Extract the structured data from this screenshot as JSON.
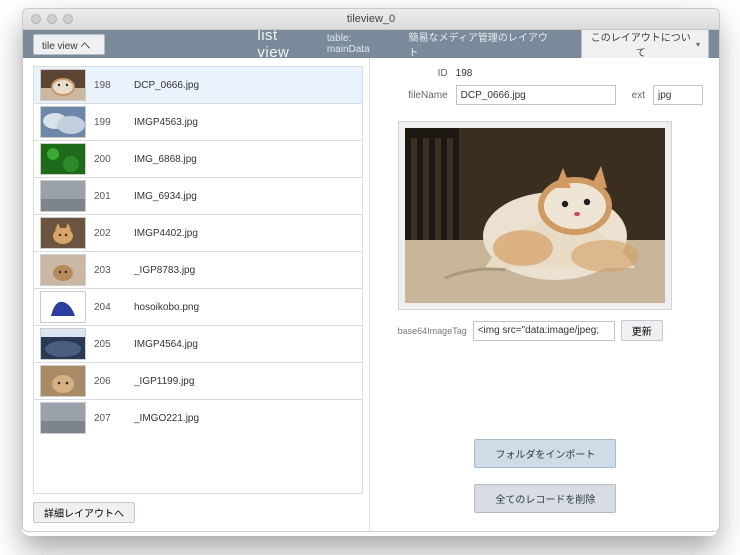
{
  "window": {
    "title": "tileview_0"
  },
  "toolbar": {
    "tileview_btn": "tile view へ",
    "listview_label": "list view",
    "table_label": "table: ",
    "table_name": "mainData",
    "description": "簡易なメディア管理のレイアウト",
    "about_btn": "このレイアウトについて"
  },
  "list": {
    "selected_id": "198",
    "rows": [
      {
        "id": "198",
        "fname": "DCP_0666.jpg",
        "thumb": "cat1"
      },
      {
        "id": "199",
        "fname": "IMGP4563.jpg",
        "thumb": "cloud1"
      },
      {
        "id": "200",
        "fname": "IMG_6868.jpg",
        "thumb": "green"
      },
      {
        "id": "201",
        "fname": "IMG_6934.jpg",
        "thumb": "gray"
      },
      {
        "id": "202",
        "fname": "IMGP4402.jpg",
        "thumb": "cat2"
      },
      {
        "id": "203",
        "fname": "_IGP8783.jpg",
        "thumb": "cat3"
      },
      {
        "id": "204",
        "fname": "hosoikobo.png",
        "thumb": "logo"
      },
      {
        "id": "205",
        "fname": "IMGP4564.jpg",
        "thumb": "cloud2"
      },
      {
        "id": "206",
        "fname": "_IGP1199.jpg",
        "thumb": "cat4"
      },
      {
        "id": "207",
        "fname": "_IMGO221.jpg",
        "thumb": "gray"
      }
    ]
  },
  "left_footer": {
    "detail_btn": "詳細レイアウトへ"
  },
  "detail": {
    "id_label": "ID",
    "id_value": "198",
    "filename_label": "fileName",
    "filename_value": "DCP_0666.jpg",
    "ext_label": "ext",
    "ext_value": "jpg",
    "b64_label": "base64ImageTag",
    "b64_value": "<img src=\"data:image/jpeg;",
    "update_btn": "更新"
  },
  "actions": {
    "import_btn": "フォルダをインポート",
    "delete_all_btn": "全てのレコードを削除"
  },
  "thumbs": {
    "cat1": "<svg viewBox='0 0 44 30'><rect width='44' height='30' fill='#5a4632'/><rect x='0' y='18' width='44' height='12' fill='#cbb8a0'/><ellipse cx='22' cy='17' rx='11' ry='8' fill='#e8dccb'/><ellipse cx='22' cy='17' rx='11' ry='8' fill='none' stroke='#c8976a' stroke-width='2'/><circle cx='18' cy='15' r='1.2' fill='#2a2a2a'/><circle cx='26' cy='15' r='1.2' fill='#2a2a2a'/></svg>",
    "cloud1": "<svg viewBox='0 0 44 30'><rect width='44' height='30' fill='#6d87a8'/><ellipse cx='14' cy='14' rx='12' ry='8' fill='#d9e2ec'/><ellipse cx='30' cy='18' rx='14' ry='9' fill='#c2cfdc'/></svg>",
    "green": "<svg viewBox='0 0 44 30'><rect width='44' height='30' fill='#1d6b1a'/><circle cx='12' cy='10' r='6' fill='#3aa833'/><circle cx='30' cy='20' r='8' fill='#2e8a28'/></svg>",
    "gray": "<svg viewBox='0 0 44 30'><rect width='44' height='30' fill='#9aa1a8'/><rect x='0' y='18' width='44' height='12' fill='#7d848b'/></svg>",
    "cat2": "<svg viewBox='0 0 44 30'><rect width='44' height='30' fill='#6b5440'/><ellipse cx='22' cy='18' rx='10' ry='8' fill='#d9a46a'/><polygon points='14,12 17,5 20,12' fill='#d9a46a'/><polygon points='24,12 27,5 30,12' fill='#d9a46a'/><circle cx='19' cy='17' r='1.2' fill='#2a2a2a'/><circle cx='25' cy='17' r='1.2' fill='#2a2a2a'/></svg>",
    "cat3": "<svg viewBox='0 0 44 30'><rect width='44' height='30' fill='#c9b9a4'/><ellipse cx='22' cy='18' rx='10' ry='8' fill='#b78b59'/><circle cx='19' cy='17' r='1.2' fill='#2a2a2a'/><circle cx='25' cy='17' r='1.2' fill='#2a2a2a'/></svg>",
    "logo": "<svg viewBox='0 0 44 30'><rect width='44' height='30' fill='#ffffff'/><path d='M10 24 Q14 8 22 10 Q30 12 34 24 Z' fill='#2a3f9e'/></svg>",
    "cloud2": "<svg viewBox='0 0 44 30'><rect width='44' height='30' fill='#2a3a55'/><ellipse cx='22' cy='20' rx='18' ry='8' fill='#4a5f80'/><rect x='0' y='0' width='44' height='8' fill='#dce5ef'/></svg>",
    "cat4": "<svg viewBox='0 0 44 30'><rect width='44' height='30' fill='#a98a66'/><ellipse cx='22' cy='18' rx='11' ry='9' fill='#d7b185'/><circle cx='18' cy='17' r='1.3' fill='#2a2a2a'/><circle cx='26' cy='17' r='1.3' fill='#2a2a2a'/></svg>",
    "preview": "<svg viewBox='0 0 260 175' preserveAspectRatio='xMidYMid slice'><rect width='260' height='175' fill='#3a2e20'/><rect x='0' y='0' width='54' height='175' fill='#1e1812'/><rect x='6' y='10' width='6' height='150' fill='#3a3226'/><rect x='18' y='10' width='6' height='150' fill='#3a3226'/><rect x='30' y='10' width='6' height='150' fill='#3a3226'/><rect x='42' y='10' width='6' height='150' fill='#3a3226'/><rect x='0' y='112' width='260' height='63' fill='#c9b69a'/><ellipse cx='150' cy='108' rx='72' ry='44' fill='#ece1d0'/><path d='M80 140 Q110 90 150 92 Q200 94 230 140 Z' fill='#e9dcc6'/><ellipse cx='170' cy='78' rx='34' ry='26' fill='#efe5d4'/><path d='M150 60 L158 40 L166 60 Z' fill='#d59a62'/><path d='M186 58 L196 38 L202 60 Z' fill='#d59a62'/><ellipse cx='170' cy='78' rx='34' ry='26' fill='none' stroke='#cf9a63' stroke-width='6'/><ellipse cx='118' cy='120' rx='30' ry='18' fill='#d6a067' opacity='.7'/><ellipse cx='200' cy='128' rx='34' ry='16' fill='#d6a067' opacity='.6'/><circle cx='160' cy='76' r='3.2' fill='#1e1e1e'/><circle cx='182' cy='74' r='3.2' fill='#1e1e1e'/><ellipse cx='172' cy='86' rx='3' ry='2' fill='#c46'/><path d='M40 150 Q70 138 100 142' stroke='#a8997f' stroke-width='3' fill='none'/></svg>"
  }
}
